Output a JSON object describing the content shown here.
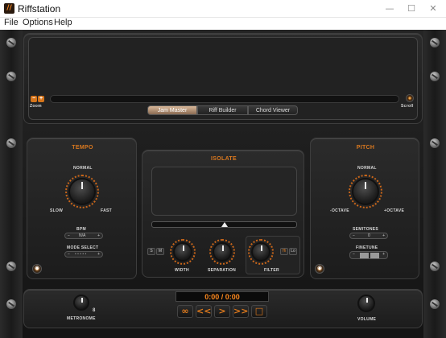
{
  "window": {
    "title": "Riffstation",
    "icon_glyph": "//",
    "minimize": "—",
    "maximize": "☐",
    "close": "✕"
  },
  "menu": [
    {
      "label": "File"
    },
    {
      "label": "Options"
    },
    {
      "label": "Help"
    }
  ],
  "waveform": {
    "zoom_minus": "−",
    "zoom_plus": "+",
    "zoom_label": "Zoom",
    "scroll_label": "Scroll"
  },
  "tabs": [
    {
      "label": "Jam Master",
      "active": true
    },
    {
      "label": "Riff Builder",
      "active": false
    },
    {
      "label": "Chord Viewer",
      "active": false
    }
  ],
  "tempo": {
    "title": "TEMPO",
    "normal": "NORMAL",
    "slow": "SLOW",
    "fast": "FAST",
    "bpm_label": "BPM",
    "bpm_minus": "−",
    "bpm_value": "N/A",
    "bpm_plus": "+",
    "mode_label": "MODE SELECT",
    "mode_minus": "−",
    "mode_value": "• • • • •",
    "mode_plus": "+"
  },
  "isolate": {
    "title": "ISOLATE",
    "s_button": "S",
    "m_button": "M",
    "width_label": "WIDTH",
    "separation_label": "SEPARATION",
    "filter_label": "FILTER",
    "hi_button": "Hi",
    "lo_button": "Lo"
  },
  "pitch": {
    "title": "PITCH",
    "normal": "NORMAL",
    "minus_octave": "-OCTAVE",
    "plus_octave": "+OCTAVE",
    "semitones_label": "SEMITONES",
    "semitones_minus": "−",
    "semitones_value": "0",
    "semitones_plus": "+",
    "finetune_label": "FINETUNE",
    "finetune_minus": "−",
    "finetune_plus": "+"
  },
  "transport": {
    "time": "0:00 / 0:00",
    "loop": "∞",
    "rewind": "<<",
    "play": ">",
    "forward": ">>",
    "stop": "□"
  },
  "metronome_label": "METRONOME",
  "volume_label": "VOLUME",
  "colors": {
    "accent": "#d9781f",
    "background": "#1b1b1b",
    "time_display": "#ff8a1e"
  }
}
